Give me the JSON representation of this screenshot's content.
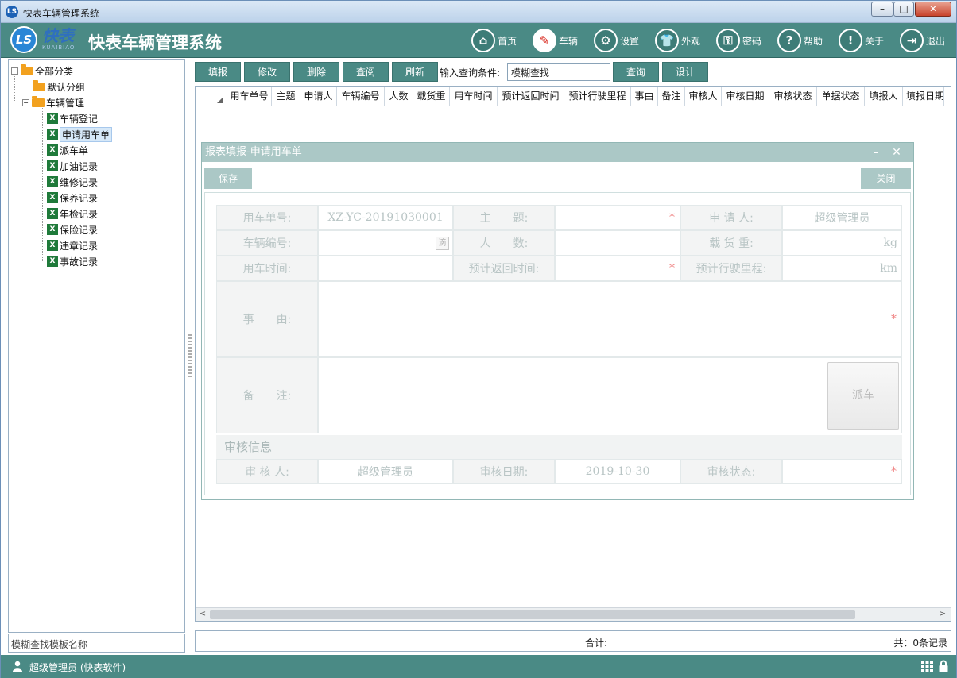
{
  "window": {
    "title": "快表车辆管理系统",
    "icon": "app-logo-icon",
    "min": "–",
    "max": "□",
    "close": "✕"
  },
  "header": {
    "logo_letters": "LS",
    "logo_cn": "快表",
    "logo_en": "KUAIBIAO",
    "title": "快表车辆管理系统",
    "nav": [
      {
        "label": "首页",
        "icon": "home-icon",
        "glyph": "⌂"
      },
      {
        "label": "车辆",
        "icon": "vehicle-icon",
        "glyph": "✎"
      },
      {
        "label": "设置",
        "icon": "gear-icon",
        "glyph": "⚙"
      },
      {
        "label": "外观",
        "icon": "shirt-icon",
        "glyph": "👕"
      },
      {
        "label": "密码",
        "icon": "key-icon",
        "glyph": "⚿"
      },
      {
        "label": "帮助",
        "icon": "help-icon",
        "glyph": "?"
      },
      {
        "label": "关于",
        "icon": "info-icon",
        "glyph": "!"
      },
      {
        "label": "退出",
        "icon": "exit-icon",
        "glyph": "⇥"
      }
    ]
  },
  "tree": {
    "root": "全部分类",
    "default_group": "默认分组",
    "vehicle_mgmt": "车辆管理",
    "items": [
      "车辆登记",
      "申请用车单",
      "派车单",
      "加油记录",
      "维修记录",
      "保养记录",
      "年检记录",
      "保险记录",
      "违章记录",
      "事故记录"
    ],
    "selected": "申请用车单",
    "xls_glyph": "X"
  },
  "left_search": {
    "placeholder": "模糊查找模板名称"
  },
  "toolbar": {
    "fill": "填报",
    "edit": "修改",
    "delete": "删除",
    "view": "查阅",
    "refresh": "刷新",
    "query_label": "输入查询条件:",
    "query_value": "模糊查找",
    "query": "查询",
    "design": "设计"
  },
  "grid": {
    "columns": [
      "用车单号",
      "主题",
      "申请人",
      "车辆编号",
      "人数",
      "载货重",
      "用车时间",
      "预计返回时间",
      "预计行驶里程",
      "事由",
      "备注",
      "审核人",
      "审核日期",
      "审核状态",
      "单据状态",
      "填报人",
      "填报日期"
    ],
    "left_arrow": "<",
    "right_arrow": ">"
  },
  "footer": {
    "total_label": "合计:",
    "count_text": "共：0条记录"
  },
  "status": {
    "user": "超级管理员 (快表软件)"
  },
  "dialog": {
    "title": "报表填报-申请用车单",
    "min": "–",
    "close": "✕",
    "save": "保存",
    "close_btn": "关闭",
    "fields": {
      "order_no_label": "用车单号:",
      "order_no": "XZ-YC-20191030001",
      "subject_label": "主　　题:",
      "subject": "",
      "applicant_label": "申 请 人:",
      "applicant": "超级管理员",
      "vehicle_label": "车辆编号:",
      "vehicle_btn": "滴",
      "people_label": "人　　数:",
      "cargo_label": "载 货 重:",
      "cargo_unit": "kg",
      "use_time_label": "用车时间:",
      "return_label": "预计返回时间:",
      "mileage_label": "预计行驶里程:",
      "mileage_unit": "km",
      "reason_label": "事　　由:",
      "remark_label": "备　　注:",
      "dispatch": "派车",
      "audit_section": "审核信息",
      "auditor_label": "审 核 人:",
      "auditor": "超级管理员",
      "audit_date_label": "审核日期:",
      "audit_date": "2019-10-30",
      "audit_status_label": "审核状态:",
      "required_mark": "*"
    }
  },
  "colors": {
    "teal": "#4a8a85",
    "dialog_teal": "#a9c7c5",
    "required": "#f08080",
    "accent_red": "#d9281e"
  }
}
